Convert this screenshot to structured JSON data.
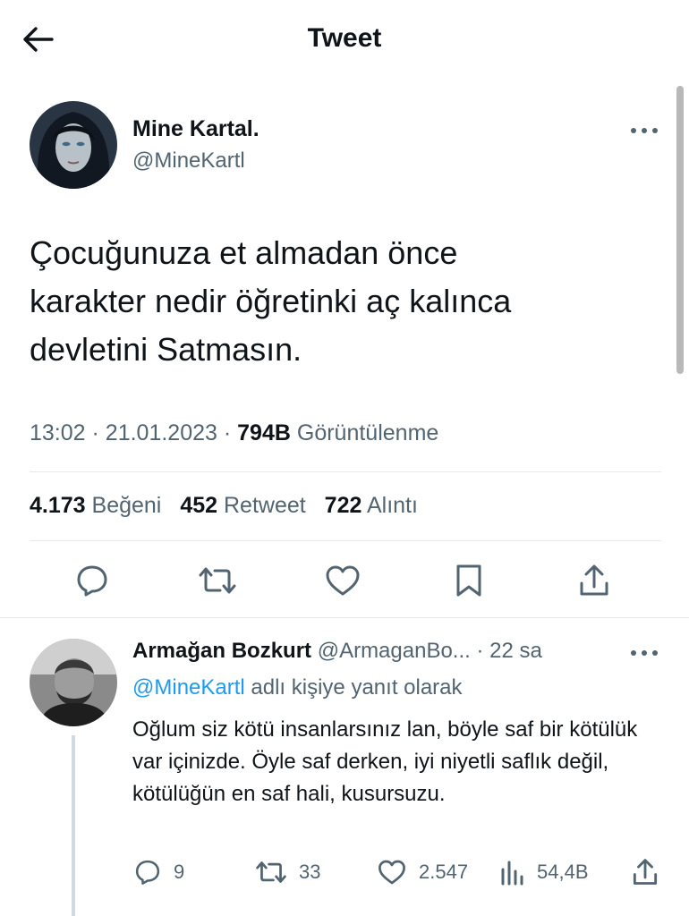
{
  "header": {
    "title": "Tweet"
  },
  "tweet": {
    "author_name": "Mine Kartal.",
    "author_handle": "@MineKartl",
    "text_lines": [
      "Çocuğunuza et almadan önce",
      "karakter nedir öğretinki aç kalınca",
      "devletini Satmasın."
    ],
    "time": "13:02",
    "date": "21.01.2023",
    "views": "794B",
    "views_label": "Görüntülenme",
    "sep": "·",
    "likes": "4.173",
    "likes_label": "Beğeni",
    "retweets": "452",
    "retweets_label": "Retweet",
    "quotes": "722",
    "quotes_label": "Alıntı"
  },
  "icons": {
    "back": "arrow-left-icon",
    "reply": "comment-icon",
    "retweet": "retweet-icon",
    "like": "heart-icon",
    "bookmark": "bookmark-icon",
    "share": "share-icon",
    "more": "more-horizontal-icon",
    "views": "analytics-icon"
  },
  "reply": {
    "author_name": "Armağan Bozkurt",
    "author_handle": "@ArmaganBo...",
    "sep": "·",
    "time": "22 sa",
    "mention": "@MineKartl",
    "reply_label": "adlı kişiye yanıt olarak",
    "text": "Oğlum siz kötü insanlarsınız lan, böyle saf bir kötülük var içinizde.  Öyle saf derken, iyi niyetli saflık değil, kötülüğün en saf hali, kusursuzu.",
    "replies": "9",
    "retweets": "33",
    "likes": "2.547",
    "views": "54,4B"
  },
  "colors": {
    "text": "#0f1419",
    "secondary": "#536471",
    "link": "#1d9bf0",
    "divider": "#e6e9eb"
  }
}
